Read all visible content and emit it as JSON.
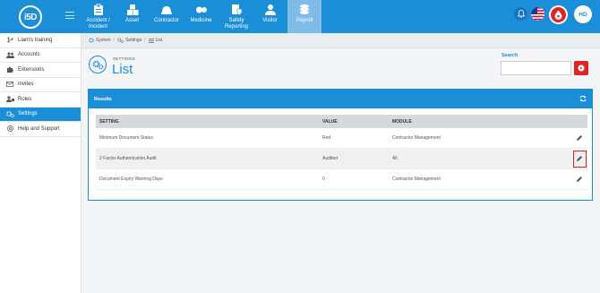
{
  "brand": {
    "logo_text": "i5D"
  },
  "nav": [
    {
      "label": "Accident / Incident",
      "icon": "clipboard-icon"
    },
    {
      "label": "Asset",
      "icon": "boxes-icon"
    },
    {
      "label": "Contractor",
      "icon": "hardhat-icon"
    },
    {
      "label": "Medicine",
      "icon": "pills-icon"
    },
    {
      "label": "Safety Reporting",
      "icon": "shield-report-icon"
    },
    {
      "label": "Visitor",
      "icon": "person-icon"
    },
    {
      "label": "Payroll",
      "icon": "coins-icon"
    }
  ],
  "user": {
    "initials": "HD"
  },
  "sidebar": {
    "items": [
      {
        "label": "Liam's training",
        "icon": "branch-icon"
      },
      {
        "label": "Accounts",
        "icon": "users-icon"
      },
      {
        "label": "Extensions",
        "icon": "puzzle-icon"
      },
      {
        "label": "Invites",
        "icon": "envelope-icon"
      },
      {
        "label": "Roles",
        "icon": "user-tag-icon"
      },
      {
        "label": "Settings",
        "icon": "cogs-icon"
      },
      {
        "label": "Help and Support",
        "icon": "help-icon"
      }
    ]
  },
  "breadcrumb": {
    "items": [
      "System",
      "Settings",
      "List"
    ]
  },
  "header": {
    "subtitle": "SETTINGS",
    "title": "List"
  },
  "search": {
    "label": "Search",
    "value": "",
    "placeholder": ""
  },
  "panel": {
    "title": "Results",
    "columns": [
      "SETTING",
      "VALUE",
      "MODULE"
    ],
    "rows": [
      {
        "setting": "Minimum Document Status",
        "value": "Red",
        "module": "Contractor Management"
      },
      {
        "setting": "2 Factor Authentication Audit",
        "value": "Audited",
        "module": "All"
      },
      {
        "setting": "Document Expiry Warning Days",
        "value": "0",
        "module": "Contractor Management"
      }
    ]
  },
  "colors": {
    "primary": "#1b8ed8",
    "danger": "#e02424",
    "active_nav": "#7fbde8"
  }
}
